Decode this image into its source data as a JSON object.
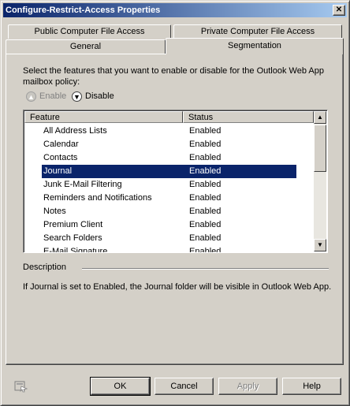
{
  "window": {
    "title": "Configure-Restrict-Access Properties",
    "close_glyph": "✕"
  },
  "tabs": [
    {
      "label": "Public Computer File Access"
    },
    {
      "label": "Private Computer File Access"
    },
    {
      "label": "General"
    },
    {
      "label": "Segmentation",
      "active": true
    }
  ],
  "panel": {
    "intro": "Select the features that you want to enable or disable for the Outlook Web App mailbox policy:",
    "enable_label": "Enable",
    "disable_label": "Disable",
    "columns": [
      "Feature",
      "Status"
    ],
    "rows": [
      {
        "feature": "All Address Lists",
        "status": "Enabled"
      },
      {
        "feature": "Calendar",
        "status": "Enabled"
      },
      {
        "feature": "Contacts",
        "status": "Enabled"
      },
      {
        "feature": "Journal",
        "status": "Enabled",
        "selected": true
      },
      {
        "feature": "Junk E-Mail Filtering",
        "status": "Enabled"
      },
      {
        "feature": "Reminders and Notifications",
        "status": "Enabled"
      },
      {
        "feature": "Notes",
        "status": "Enabled"
      },
      {
        "feature": "Premium Client",
        "status": "Enabled"
      },
      {
        "feature": "Search Folders",
        "status": "Enabled"
      },
      {
        "feature": "E-Mail Signature",
        "status": "Enabled"
      }
    ],
    "description_title": "Description",
    "description_text": "If Journal is set to Enabled, the Journal folder will be visible in Outlook Web App."
  },
  "buttons": {
    "ok": "OK",
    "cancel": "Cancel",
    "apply": "Apply",
    "help": "Help"
  },
  "colors": {
    "selection": "#0a246a",
    "face": "#d4d0c8"
  }
}
